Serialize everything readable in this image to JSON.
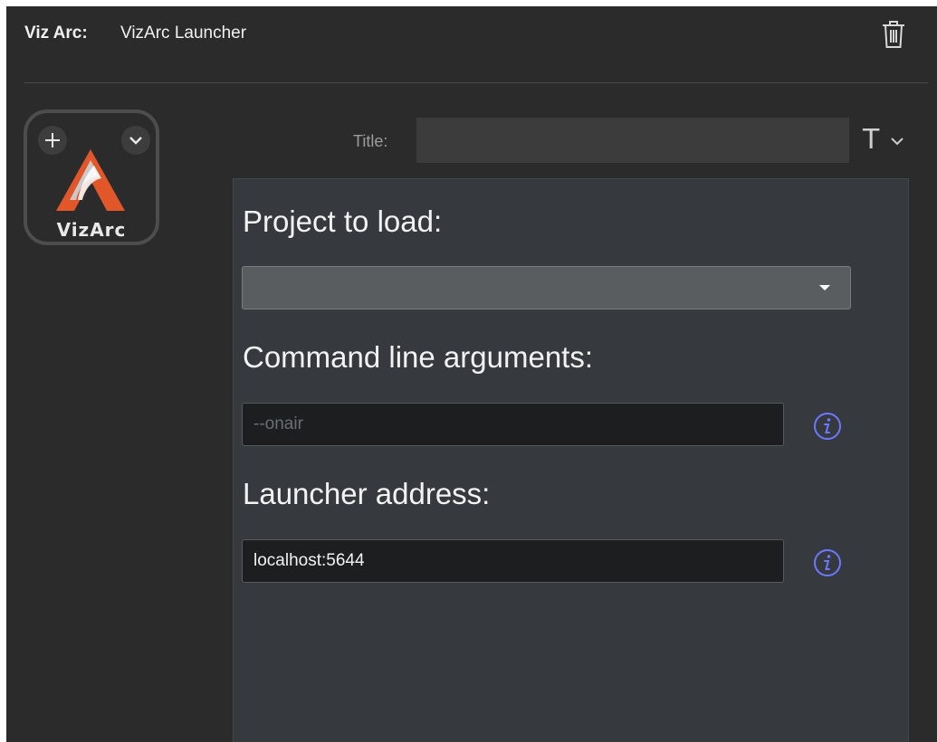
{
  "header": {
    "app_label": "Viz Arc:",
    "app_name": "VizArc Launcher",
    "delete_icon": "trash-icon"
  },
  "tile": {
    "logo_text": "VizArc",
    "add_icon": "plus-icon",
    "menu_icon": "chevron-down-icon"
  },
  "title_field": {
    "label": "Title:",
    "value": "",
    "format_glyph": "T",
    "format_icon": "text-format-icon"
  },
  "form": {
    "project": {
      "label": "Project to load:",
      "value": ""
    },
    "args": {
      "label": "Command line arguments:",
      "value": "",
      "placeholder": "--onair",
      "info_icon": "info-icon"
    },
    "address": {
      "label": "Launcher address:",
      "value": "localhost:5644",
      "info_icon": "info-icon"
    }
  },
  "colors": {
    "background": "#2b2b2b",
    "panel": "#363a3e",
    "accent_info": "#6b78ff",
    "logo_orange": "#e2572a"
  }
}
